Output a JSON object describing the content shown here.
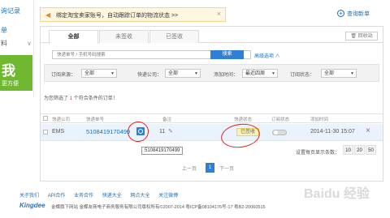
{
  "sidebar": {
    "item1": "询记录",
    "item2": "单",
    "item3": "料",
    "banner_big": "我",
    "banner_small": "更方便"
  },
  "notice": {
    "message": "绑定淘宝卖家账号，自动跟踪订单的物流状态 >>",
    "close": "×"
  },
  "header": {
    "query_new": "查询新单"
  },
  "tabs": [
    "全部",
    "未签收",
    "已签收"
  ],
  "recycle": "回收站",
  "search": {
    "placeholder": "快递单号 / 手机号码搜索",
    "button": "搜索",
    "advanced": "高级选项 ∧"
  },
  "filters": [
    {
      "label": "订阅来源：",
      "value": "全部"
    },
    {
      "label": "快递公司：",
      "value": "全部"
    },
    {
      "label": "添加时间：",
      "value": "最近四周"
    },
    {
      "label": "订阅状态：",
      "value": "全部"
    }
  ],
  "result": {
    "prefix": "为您筛选了",
    "count": "1",
    "suffix": "个符合条件的订单！"
  },
  "table": {
    "headers": [
      "快递公司",
      "快递单号",
      "备注",
      "快递状态",
      "订阅状态",
      "添加时间"
    ],
    "rows": [
      {
        "company": "EMS",
        "tracking": "5108419170499",
        "note": "11",
        "status": "已签收",
        "time": "2014-11-30 15:07",
        "delete": "×"
      }
    ]
  },
  "tooltip": "5108419170499",
  "page_size": {
    "label": "设置每页显示条数：",
    "options": [
      "10",
      "20",
      "50"
    ]
  },
  "pager": {
    "prev": "上一页",
    "current": "1",
    "next": "下一页"
  },
  "footer": {
    "links": [
      "关于我们",
      "API合作",
      "业务合作",
      "快递大全",
      "网点大全",
      "关注微博"
    ],
    "logo": "Kingdee",
    "copyright": "金蝶旗下网站    金蝶友商电子商务服务有限公司版权所有©2007-2014  粤ICP备08104176号-17  粤B2-20060515"
  },
  "watermark": "Baidu 经验",
  "colors": {
    "accent": "#2f7fd7",
    "link": "#1d6fb8",
    "banner_green": "#6fb830",
    "annotation_red": "#e02020"
  }
}
